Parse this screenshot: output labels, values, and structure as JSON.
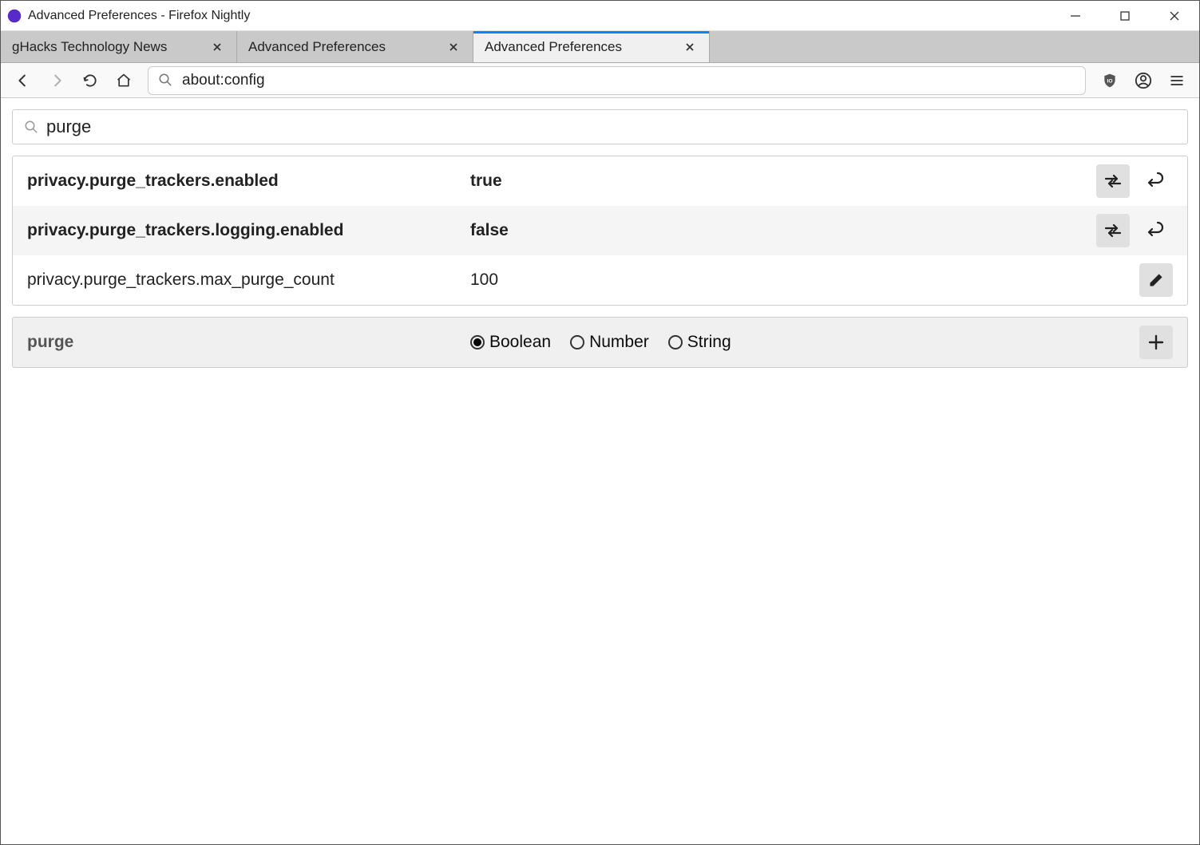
{
  "window": {
    "title": "Advanced Preferences - Firefox Nightly"
  },
  "tabs": [
    {
      "label": "gHacks Technology News",
      "active": false
    },
    {
      "label": "Advanced Preferences",
      "active": false
    },
    {
      "label": "Advanced Preferences",
      "active": true
    }
  ],
  "urlbar": {
    "text": "about:config"
  },
  "config": {
    "search_value": "purge",
    "prefs": [
      {
        "name": "privacy.purge_trackers.enabled",
        "value": "true",
        "modified": true,
        "edit_type": "toggle",
        "has_reset": true
      },
      {
        "name": "privacy.purge_trackers.logging.enabled",
        "value": "false",
        "modified": true,
        "edit_type": "toggle",
        "has_reset": true
      },
      {
        "name": "privacy.purge_trackers.max_purge_count",
        "value": "100",
        "modified": false,
        "edit_type": "edit",
        "has_reset": false
      }
    ],
    "new_pref": {
      "name": "purge",
      "types": [
        {
          "label": "Boolean",
          "selected": true
        },
        {
          "label": "Number",
          "selected": false
        },
        {
          "label": "String",
          "selected": false
        }
      ]
    }
  }
}
